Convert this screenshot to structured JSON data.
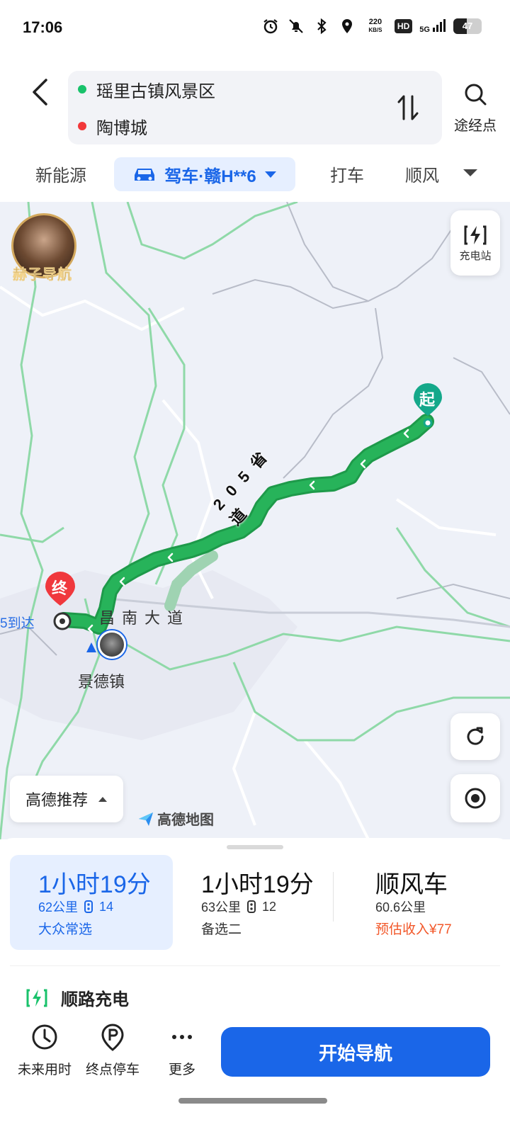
{
  "status_bar": {
    "time": "17:06",
    "net_speed_value": "220",
    "net_speed_unit": "KB/S",
    "hd": "HD",
    "signal": "5G",
    "battery": "47",
    "battery_level": 0.47
  },
  "header": {
    "origin": "瑶里古镇风景区",
    "destination": "陶博城",
    "via_label": "途经点"
  },
  "modes": {
    "new_energy": "新能源",
    "drive": "驾车·赣H**6",
    "taxi": "打车",
    "carpool": "顺风"
  },
  "map": {
    "avatar_text": "赫子导航",
    "charging_station_label": "充电站",
    "road_label": "205省道",
    "road_chars": [
      "2",
      "0",
      "5",
      "省",
      "道"
    ],
    "avenue_label": "昌南大道",
    "city_label": "景德镇",
    "arrive_text": "5到达",
    "start_marker": "起",
    "end_marker": "终",
    "recommend_label": "高德推荐",
    "logo_label": "高德地图",
    "colors": {
      "route": "#27b35a",
      "route_border": "#1e9a4a",
      "start_marker": "#14a88a",
      "end_marker": "#f0383d"
    }
  },
  "plans": [
    {
      "time": "1小时19分",
      "distance": "62公里",
      "lights": "14",
      "tag": "大众常选"
    },
    {
      "time": "1小时19分",
      "distance": "63公里",
      "lights": "12",
      "tag": "备选二"
    },
    {
      "time": "顺风车",
      "distance": "60.6公里",
      "tag": "预估收入¥77"
    }
  ],
  "charge_row": "顺路充电",
  "bottom_bar": {
    "future_time": "未来用时",
    "parking": "终点停车",
    "more": "更多",
    "start_nav": "开始导航"
  }
}
